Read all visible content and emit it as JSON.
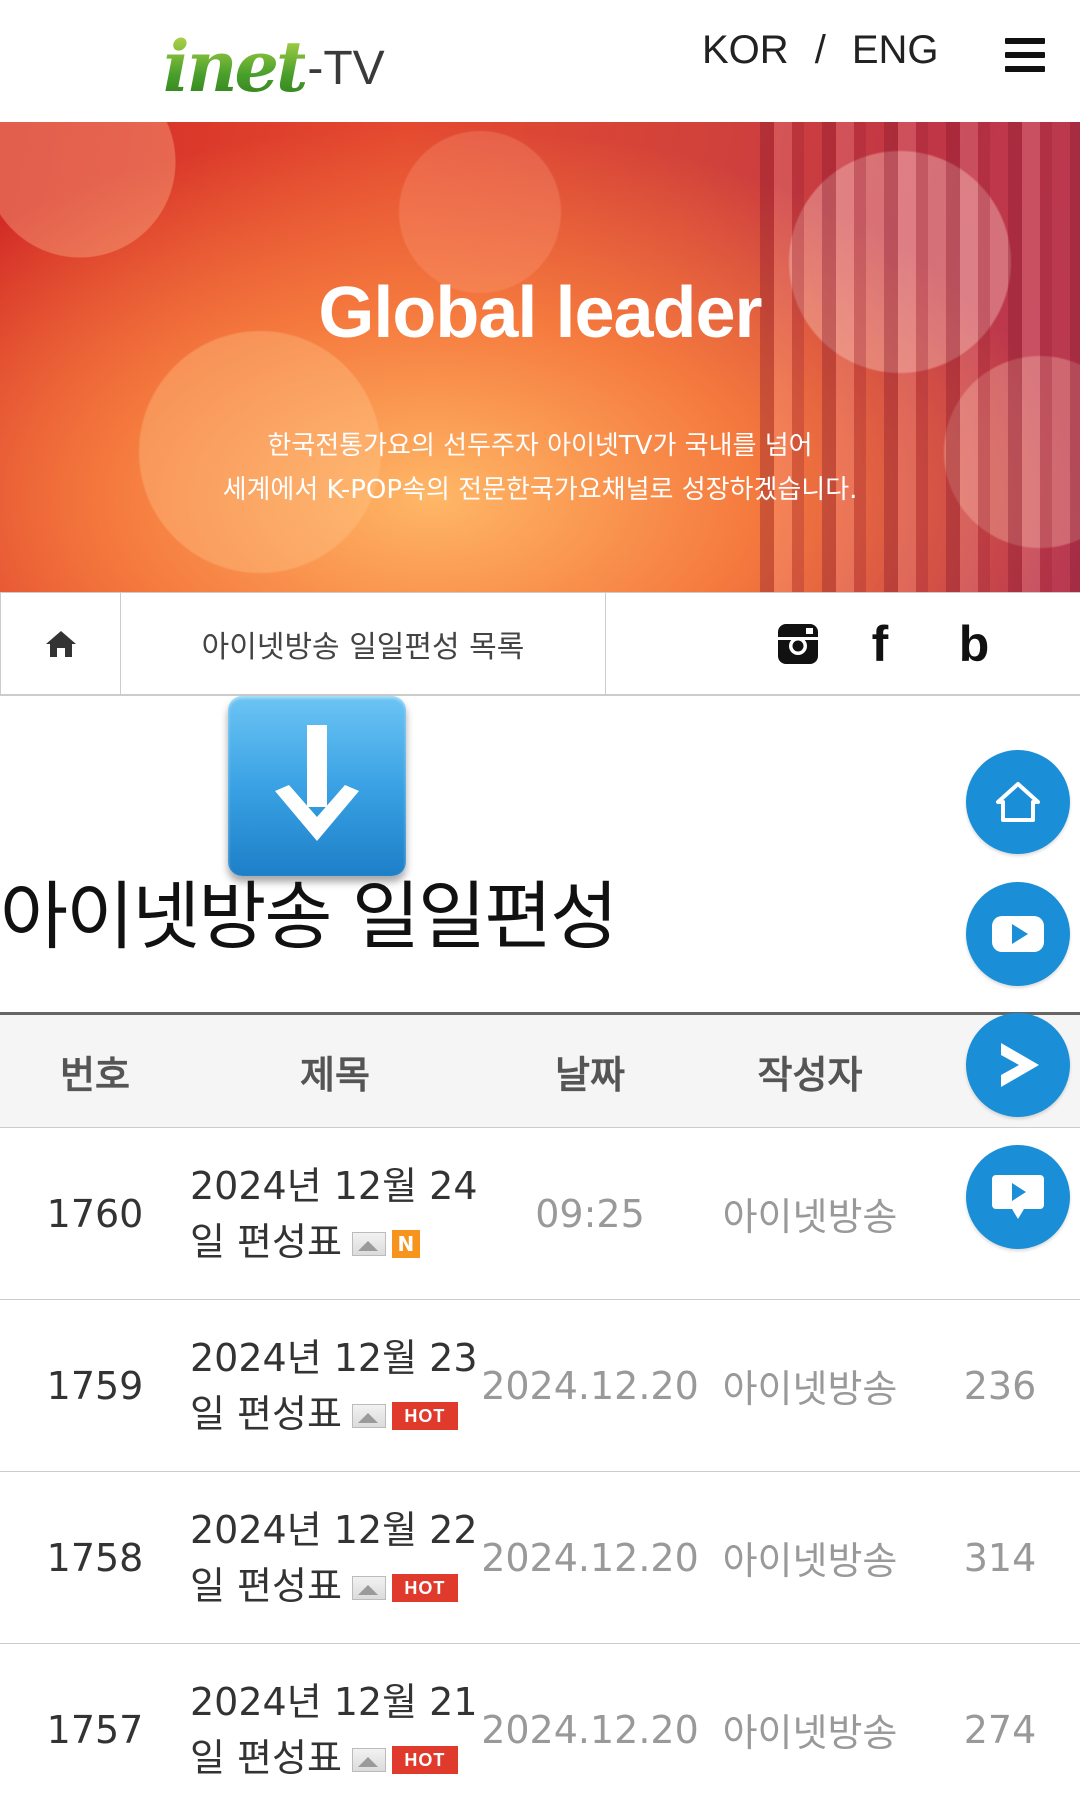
{
  "header": {
    "logo_main": "inet",
    "logo_suffix": "-TV",
    "lang_kor": "KOR",
    "lang_sep": "/",
    "lang_eng": "ENG"
  },
  "banner": {
    "title": "Global leader",
    "subtitle_line1": "한국전통가요의 선두주자 아이넷TV가 국내를 넘어",
    "subtitle_line2": "세계에서 K-POP속의 전문한국가요채널로 성장하겠습니다."
  },
  "breadcrumb": {
    "current": "아이넷방송 일일편성 목록"
  },
  "social": {
    "facebook": "f",
    "blog": "b"
  },
  "page": {
    "heading": "아이넷방송 일일편성"
  },
  "table": {
    "headers": {
      "num": "번호",
      "title": "제목",
      "date": "날짜",
      "author": "작성자"
    },
    "rows": [
      {
        "num": "1760",
        "title_line1": "2024년 12월 24",
        "title_line2": "일 편성표",
        "badge": "N",
        "date": "09:25",
        "author": "아이넷방송",
        "views": ""
      },
      {
        "num": "1759",
        "title_line1": "2024년 12월 23",
        "title_line2": "일 편성표",
        "badge": "HOT",
        "date": "2024.12.20",
        "author": "아이넷방송",
        "views": "236"
      },
      {
        "num": "1758",
        "title_line1": "2024년 12월 22",
        "title_line2": "일 편성표",
        "badge": "HOT",
        "date": "2024.12.20",
        "author": "아이넷방송",
        "views": "314"
      },
      {
        "num": "1757",
        "title_line1": "2024년 12월 21",
        "title_line2": "일 편성표",
        "badge": "HOT",
        "date": "2024.12.20",
        "author": "아이넷방송",
        "views": "274"
      }
    ]
  },
  "colors": {
    "fab_blue": "#1a8ed6",
    "hot_red": "#e03a2c",
    "new_orange": "#f7941d"
  },
  "icons": {
    "fab1": "home-outline-icon",
    "fab2": "youtube-play-icon",
    "fab3": "play-arrow-icon",
    "fab4": "chat-play-icon"
  }
}
